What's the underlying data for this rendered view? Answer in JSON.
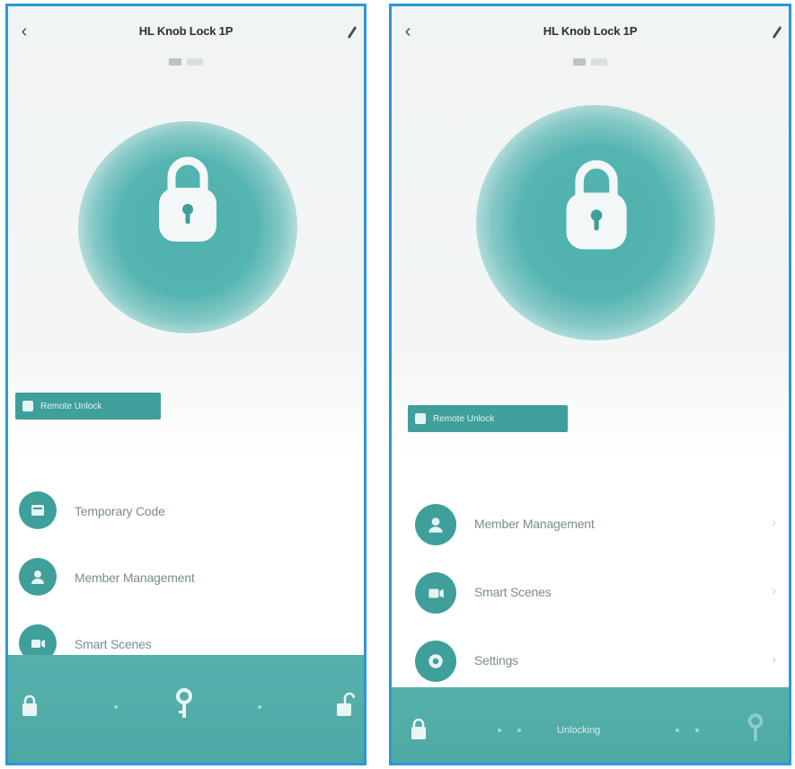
{
  "colors": {
    "accent": "#3f9f9a",
    "bar": "#52aca7",
    "frame": "#2a98d8"
  },
  "left": {
    "title": "HL Knob Lock 1P",
    "remote_button_label": "Remote Unlock",
    "menu": [
      {
        "label": "Temporary Code",
        "icon": "temporary-code-icon"
      },
      {
        "label": "Member Management",
        "icon": "member-icon"
      },
      {
        "label": "Smart Scenes",
        "icon": "scene-icon"
      }
    ]
  },
  "right": {
    "title": "HL Knob Lock 1P",
    "remote_button_label": "Remote Unlock",
    "menu": [
      {
        "label": "Member Management",
        "icon": "member-icon"
      },
      {
        "label": "Smart Scenes",
        "icon": "scene-icon"
      },
      {
        "label": "Settings",
        "icon": "settings-icon"
      }
    ],
    "bottom_label": "Unlocking"
  }
}
